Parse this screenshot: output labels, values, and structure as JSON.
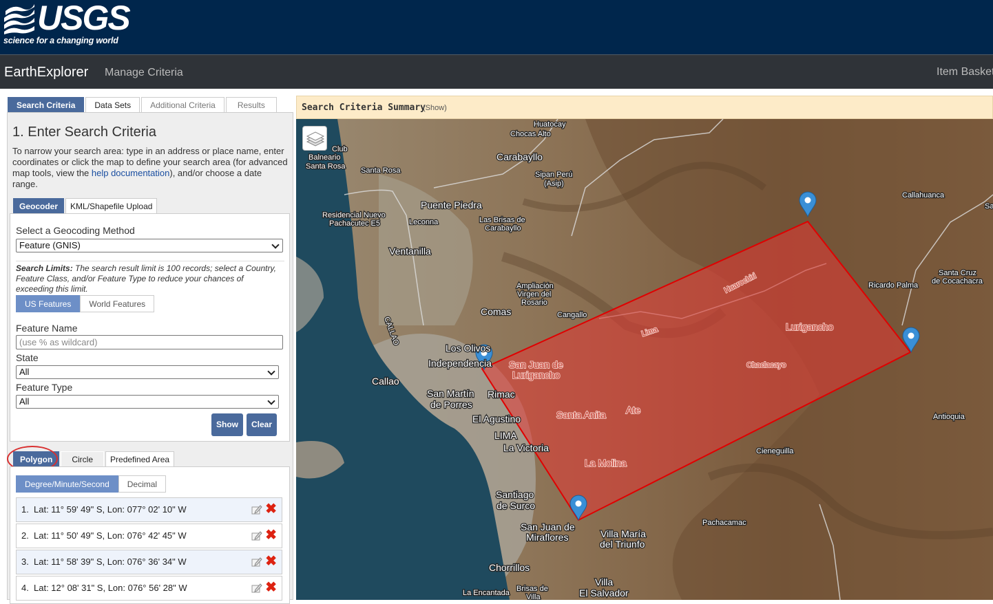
{
  "header": {
    "logo_text": "USGS",
    "tagline": "science for a changing world"
  },
  "nav": {
    "app_title": "EarthExplorer",
    "manage_criteria": "Manage Criteria",
    "item_basket": "Item Basket"
  },
  "main_tabs": [
    "Search Criteria",
    "Data Sets",
    "Additional Criteria",
    "Results"
  ],
  "criteria": {
    "heading": "1. Enter Search Criteria",
    "intro_before_link": "To narrow your search area: type in an address or place name, enter coordinates or click the map to define your search area (for advanced map tools, view the ",
    "intro_link": "help documentation",
    "intro_after_link": "), and/or choose a date range."
  },
  "geo_tabs": [
    "Geocoder",
    "KML/Shapefile Upload"
  ],
  "geocoder": {
    "method_label": "Select a Geocoding Method",
    "method_value": "Feature (GNIS)",
    "limits_bold": "Search Limits:",
    "limits_text": " The search result limit is 100 records; select a Country, Feature Class, and/or Feature Type to reduce your chances of exceeding this limit.",
    "feature_tabs": [
      "US Features",
      "World Features"
    ],
    "feature_name_label": "Feature Name",
    "feature_name_placeholder": "(use % as wildcard)",
    "state_label": "State",
    "state_value": "All",
    "feature_type_label": "Feature Type",
    "feature_type_value": "All",
    "show_button": "Show",
    "clear_button": "Clear"
  },
  "shape_tabs": [
    "Polygon",
    "Circle",
    "Predefined Area"
  ],
  "coord_tabs": [
    "Degree/Minute/Second",
    "Decimal"
  ],
  "coordinates": [
    {
      "index": "1.",
      "text": "Lat: 11° 59' 49\" S, Lon: 077° 02' 10\" W"
    },
    {
      "index": "2.",
      "text": "Lat: 11° 50' 49\" S, Lon: 076° 42' 45\" W"
    },
    {
      "index": "3.",
      "text": "Lat: 11° 58' 39\" S, Lon: 076° 36' 34\" W"
    },
    {
      "index": "4.",
      "text": "Lat: 12° 08' 31\" S, Lon: 076° 56' 28\" W"
    }
  ],
  "map": {
    "summary_title": "Search Criteria Summary",
    "summary_show": "(Show)",
    "colors": {
      "polygon_fill": "#e53935",
      "polygon_stroke": "#e00000",
      "marker": "#3a8fd6",
      "sea": "#1f4a5e"
    },
    "labels": {
      "huatocay": "Huatocay",
      "chocas_alto": "Chocas Alto",
      "club": "Club",
      "balneario": "Balneario",
      "santa_rosa_1": "Santa Rosa",
      "santa_rosa_2": "Santa Rosa",
      "carabayllo": "Carabayllo",
      "sipan_peru": "Sipan Perú",
      "asip": "(Asip)",
      "puente_piedra": "Puente Piedra",
      "res_nuevo": "Residencial Nuevo",
      "pachacutec": "Pachacutec E5",
      "leconna": "Leconna",
      "las_brisas_1": "Las Brisas de",
      "las_brisas_2": "Carabayllo",
      "ventanilla": "Ventanilla",
      "ampliacion": "Ampliación",
      "virgen": "Virgen del",
      "rosario": "Rosario",
      "comas": "Comas",
      "cangallo": "Cangallo",
      "callao_vertical": "CALLAO",
      "los_olivos": "Los Olivos",
      "independencia": "Independencia",
      "callao": "Callao",
      "san_martin": "San Martín",
      "de_porres": "de Porres",
      "rimac": "Rimac",
      "el_agustino": "El Agustino",
      "lima": "LIMA",
      "la_victoria": "La Victoria",
      "santiago": "Santiago",
      "de_surco": "de Surco",
      "sjm": "San Juan de",
      "miraflores": "Miraflores",
      "chorrillos": "Chorrillos",
      "villa_maria": "Villa María",
      "del_triunfo": "del Triunfo",
      "villa": "Villa",
      "el_salvador": "El Salvador",
      "la_encantada": "La Encantada",
      "brisas": "Brisas de",
      "villa2": "Villa",
      "pachacamac": "Pachacamac",
      "cieneguilla": "Cieneguilla",
      "antioquia": "Antioquia",
      "callahuanca": "Callahuanca",
      "santa_cruz": "Santa Cruz",
      "cocachacra": "de Cocachacra",
      "ricardo_palma": "Ricardo Palma",
      "sa": "Sa",
      "sjl_1": "San Juan de",
      "sjl_2": "Lurigancho",
      "lurigancho": "Lurigancho",
      "chaclacayo": "Chaclacayo",
      "santa_anita": "Santa Anita",
      "ate": "Ate",
      "la_molina": "La Molina",
      "huarochiri": "Huarochiri",
      "lima_prov": "Lima"
    }
  }
}
